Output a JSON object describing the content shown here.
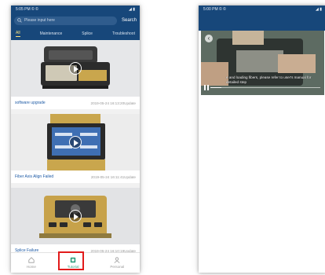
{
  "left_phone": {
    "status": {
      "time": "5:05 PM © ©",
      "icons": "◢ ▮"
    },
    "search": {
      "placeholder": "Please input here",
      "button": "Search"
    },
    "tabs": [
      {
        "label": "All"
      },
      {
        "label": "Maintenance"
      },
      {
        "label": "Splice"
      },
      {
        "label": "Troubleshoot"
      }
    ],
    "cards": [
      {
        "title": "software upgrade",
        "date": "2019-05-24 16:13:20Update"
      },
      {
        "title": "Fiber Axis Align Failed",
        "date": "2019-05-24 16:11:41Update"
      },
      {
        "title": "Splice Failure",
        "date": "2019-05-24 16:10:19Update"
      }
    ],
    "nav": [
      {
        "label": "Home"
      },
      {
        "label": "Tutorial"
      },
      {
        "label": "Personal"
      }
    ]
  },
  "right_phone": {
    "status": {
      "time": "5:00 PM © ©",
      "icons": "◢ ▮"
    },
    "video": {
      "subtitle": "e and loading fibers, please refer to user's manual for detailed step",
      "progress": 0.1
    }
  },
  "colors": {
    "header": "#17477a",
    "active_tab": "#ffe27a",
    "highlight": "#e21b1b",
    "nav_active": "#2d9e7d"
  }
}
